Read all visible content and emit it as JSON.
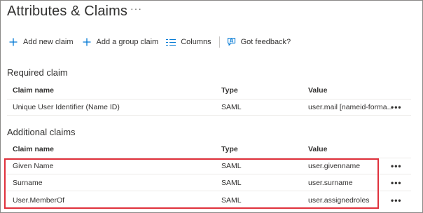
{
  "page": {
    "title": "Attributes & Claims",
    "more_label": "···"
  },
  "toolbar": {
    "add_new_claim": "Add new claim",
    "add_group_claim": "Add a group claim",
    "columns": "Columns",
    "feedback": "Got feedback?"
  },
  "required": {
    "title": "Required claim",
    "headers": {
      "name": "Claim name",
      "type": "Type",
      "value": "Value"
    },
    "rows": [
      {
        "name": "Unique User Identifier (Name ID)",
        "type": "SAML",
        "value": "user.mail [nameid-forma...",
        "more": "•••"
      }
    ]
  },
  "additional": {
    "title": "Additional claims",
    "headers": {
      "name": "Claim name",
      "type": "Type",
      "value": "Value"
    },
    "rows": [
      {
        "name": "Given Name",
        "type": "SAML",
        "value": "user.givenname",
        "more": "•••"
      },
      {
        "name": "Surname",
        "type": "SAML",
        "value": "user.surname",
        "more": "•••"
      },
      {
        "name": "User.MemberOf",
        "type": "SAML",
        "value": "user.assignedroles",
        "more": "•••"
      }
    ]
  },
  "colors": {
    "accent": "#0078d4",
    "highlight_border": "#e0313c"
  },
  "icons": {
    "add": "plus-icon",
    "columns": "columns-icon",
    "feedback": "feedback-icon",
    "more": "more-icon"
  }
}
